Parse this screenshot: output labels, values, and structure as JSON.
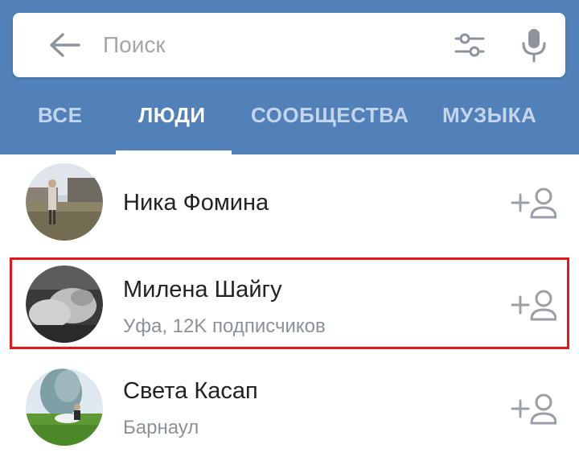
{
  "search": {
    "placeholder": "Поиск",
    "value": ""
  },
  "tabs": [
    {
      "label": "ВСЕ",
      "active": false
    },
    {
      "label": "ЛЮДИ",
      "active": true
    },
    {
      "label": "СООБЩЕСТВА",
      "active": false
    },
    {
      "label": "МУЗЫКА",
      "active": false
    }
  ],
  "results": [
    {
      "name": "Ника Фомина",
      "subtitle": "",
      "action_icon": "add-friend-icon"
    },
    {
      "name": "Милена Шайгу",
      "subtitle": "Уфа, 12K подписчиков",
      "action_icon": "add-friend-icon"
    },
    {
      "name": "Света Касап",
      "subtitle": "Барнаул",
      "action_icon": "add-friend-icon"
    }
  ],
  "colors": {
    "header": "#5181b8",
    "active_tab": "#ffffff",
    "inactive_tab": "#c3d5ea",
    "icon": "#9a9fa6",
    "highlight": "#e4171f"
  }
}
